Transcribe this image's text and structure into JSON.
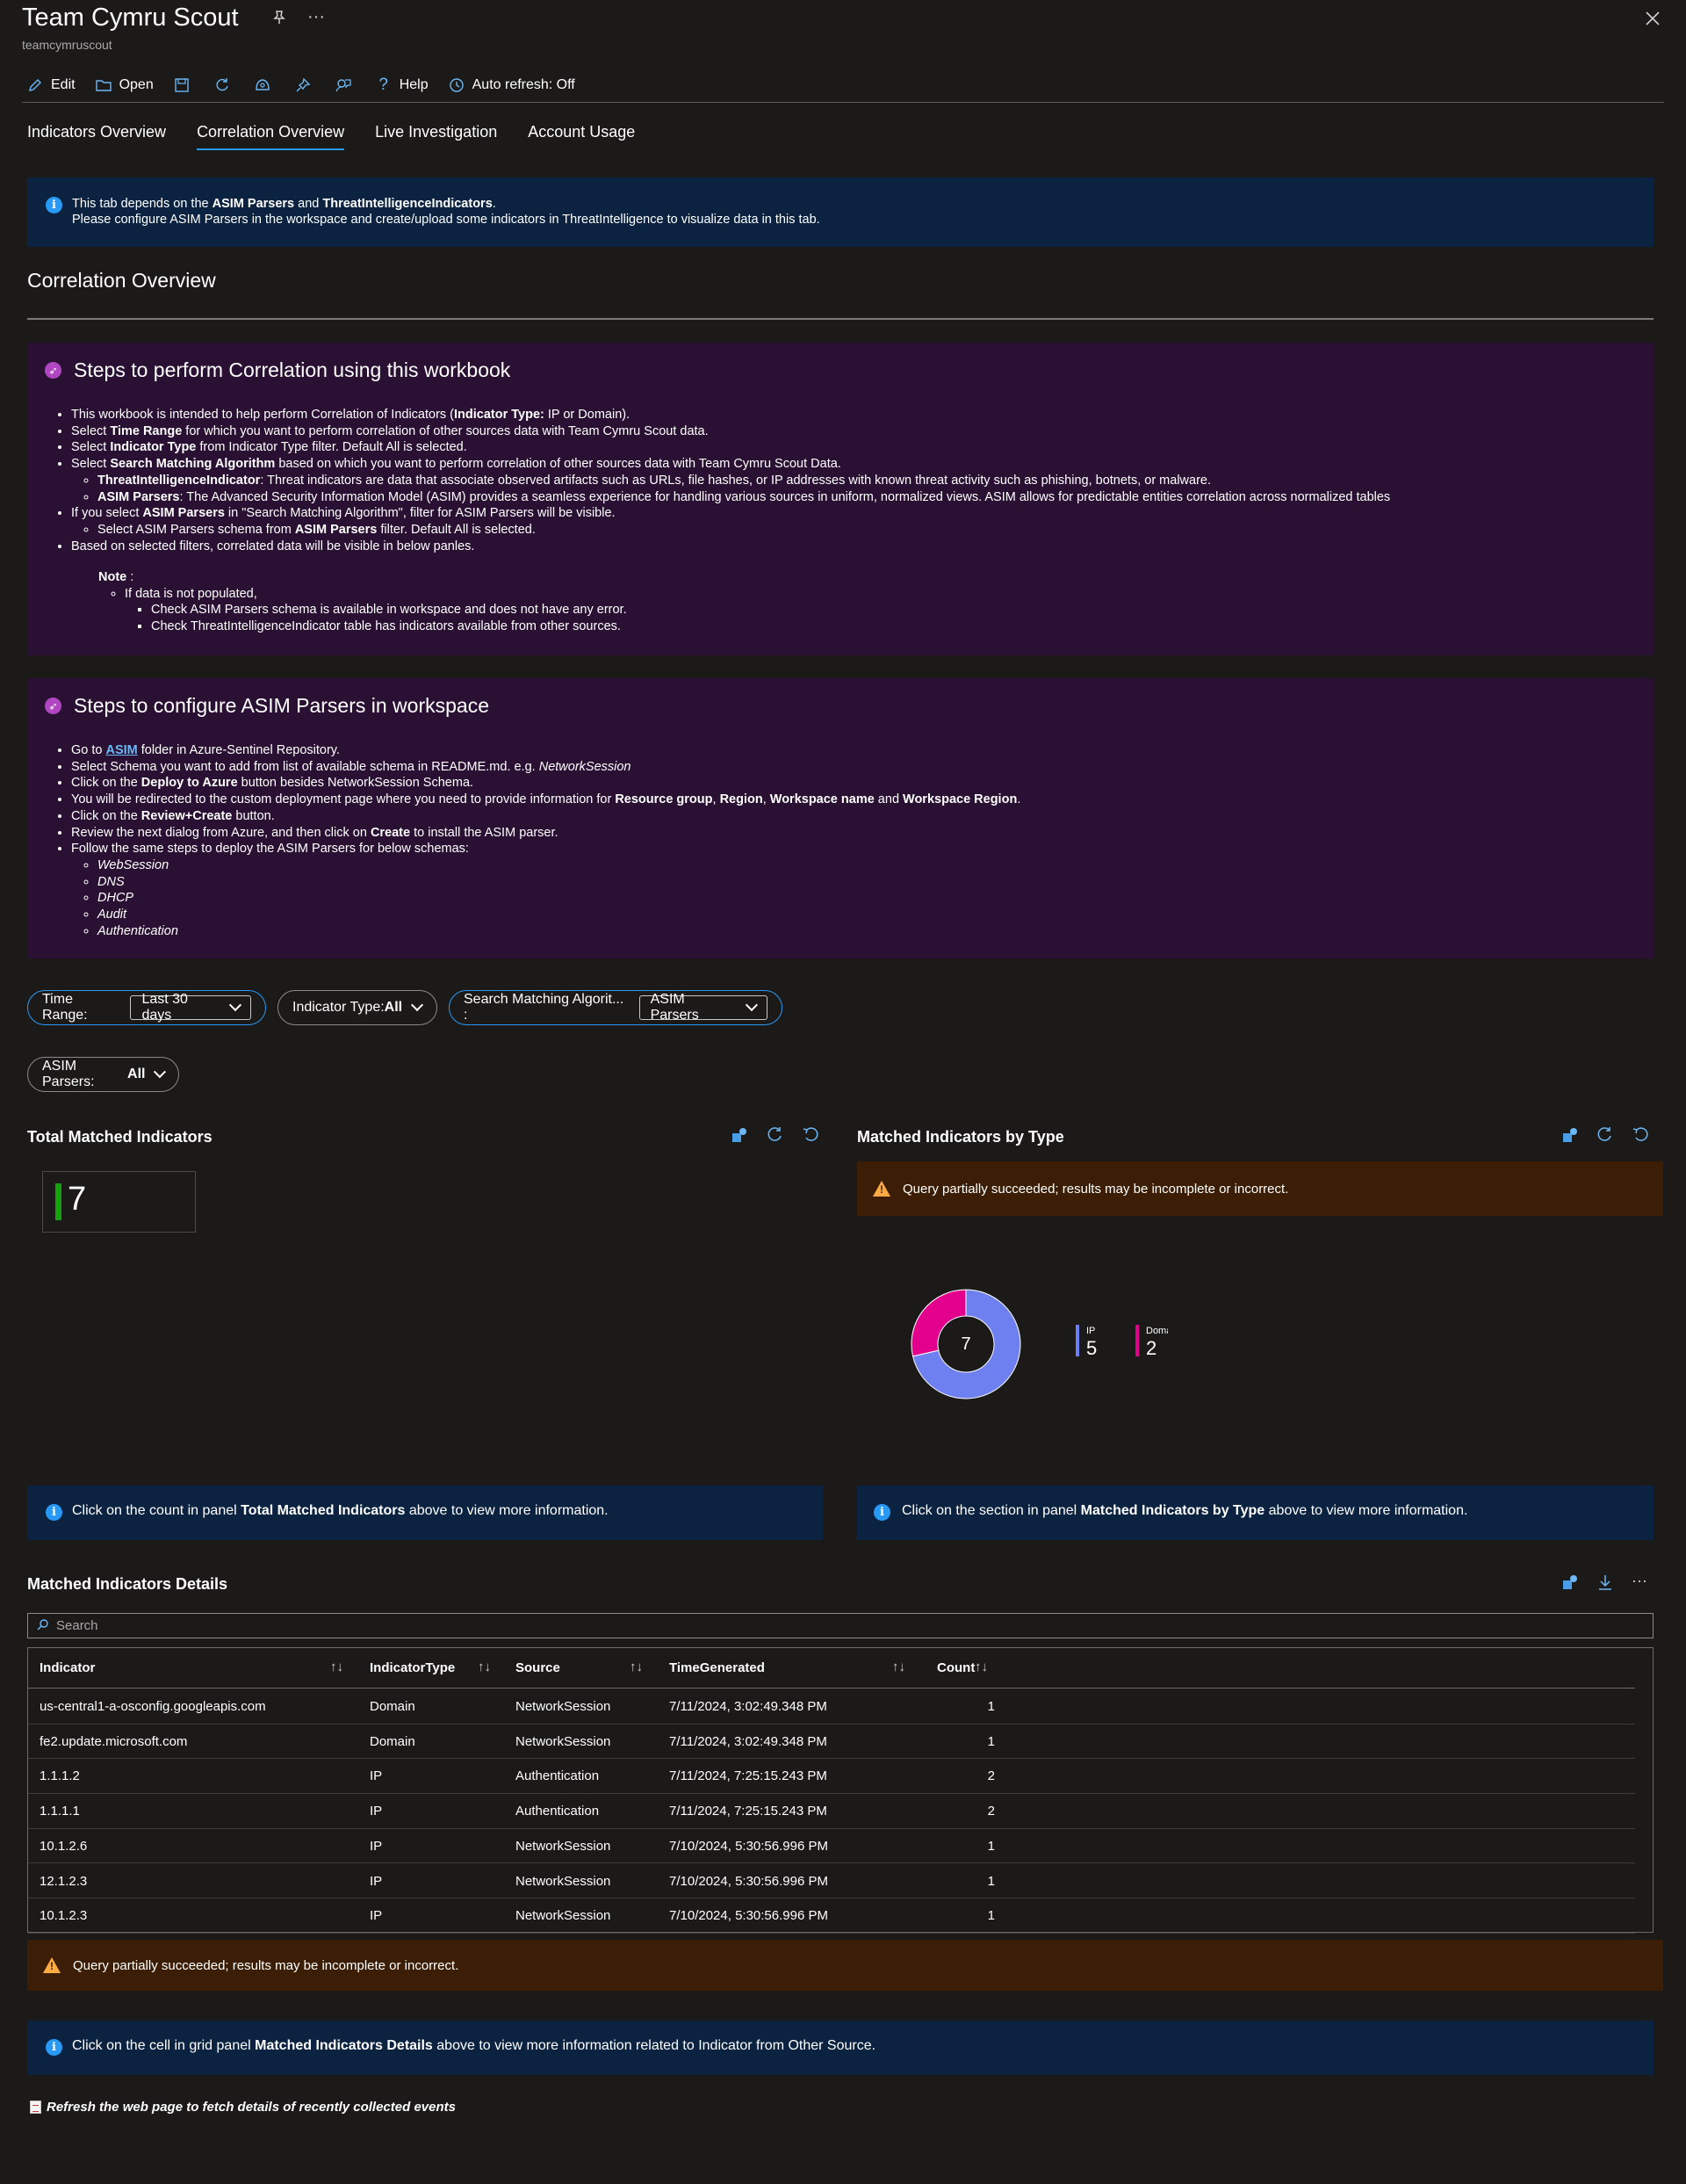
{
  "header": {
    "title": "Team Cymru Scout",
    "subtitle": "teamcymruscout"
  },
  "toolbar": {
    "edit": "Edit",
    "open": "Open",
    "help": "Help",
    "auto_refresh": "Auto refresh: Off"
  },
  "tabs": [
    {
      "label": "Indicators Overview",
      "active": false
    },
    {
      "label": "Correlation Overview",
      "active": true
    },
    {
      "label": "Live Investigation",
      "active": false
    },
    {
      "label": "Account Usage",
      "active": false
    }
  ],
  "top_banner": {
    "l1_a": "This tab depends on the ",
    "l1_b": "ASIM Parsers",
    "l1_c": " and ",
    "l1_d": "ThreatIntelligenceIndicators",
    "l1_e": ".",
    "line2": "Please configure ASIM Parsers in the workspace and create/upload some indicators in ThreatIntelligence to visualize data in this tab."
  },
  "section_title": "Correlation Overview",
  "steps_correlation": {
    "heading": "Steps to perform Correlation using this workbook",
    "b1_a": "This workbook is intended to help perform Correlation of Indicators (",
    "b1_b": "Indicator Type:",
    "b1_c": " IP or Domain).",
    "b2_a": "Select ",
    "b2_b": "Time Range",
    "b2_c": " for which you want to perform correlation of other sources data with Team Cymru Scout data.",
    "b3_a": "Select ",
    "b3_b": "Indicator Type",
    "b3_c": " from Indicator Type filter. Default All is selected.",
    "b4_a": "Select ",
    "b4_b": "Search Matching Algorithm",
    "b4_c": " based on which you want to perform correlation of other sources data with Team Cymru Scout Data.",
    "b4s1_a": "ThreatIntelligenceIndicator",
    "b4s1_b": ": Threat indicators are data that associate observed artifacts such as URLs, file hashes, or IP addresses with known threat activity such as phishing, botnets, or malware.",
    "b4s2_a": "ASIM Parsers",
    "b4s2_b": ": The Advanced Security Information Model (ASIM) provides a seamless experience for handling various sources in uniform, normalized views. ASIM allows for predictable entities correlation across normalized tables",
    "b5_a": "If you select ",
    "b5_b": "ASIM Parsers",
    "b5_c": " in \"Search Matching Algorithm\", filter for ASIM Parsers will be visible.",
    "b5s1_a": "Select ASIM Parsers schema from ",
    "b5s1_b": "ASIM Parsers",
    "b5s1_c": " filter. Default All is selected.",
    "b6": "Based on selected filters, correlated data will be visible in below panles.",
    "note": "Note",
    "note_colon": " :",
    "n1": "If data is not populated,",
    "n1s1": "Check ASIM Parsers schema is available in workspace and does not have any error.",
    "n1s2": "Check ThreatIntelligenceIndicator table has indicators available from other sources."
  },
  "steps_asim": {
    "heading": "Steps to configure ASIM Parsers in workspace",
    "b1_a": "Go to ",
    "b1_link": "ASIM",
    "b1_c": " folder in Azure-Sentinel Repository.",
    "b2_a": "Select Schema you want to add from list of available schema in README.md. e.g. ",
    "b2_b": "NetworkSession",
    "b3_a": "Click on the ",
    "b3_b": "Deploy to Azure",
    "b3_c": " button besides NetworkSession Schema.",
    "b4_a": "You will be redirected to the custom deployment page where you need to provide information for ",
    "b4_b": "Resource group",
    "b4_c": ", ",
    "b4_d": "Region",
    "b4_e": ", ",
    "b4_f": "Workspace name",
    "b4_g": " and ",
    "b4_h": "Workspace Region",
    "b4_i": ".",
    "b5_a": "Click on the ",
    "b5_b": "Review+Create",
    "b5_c": " button.",
    "b6_a": "Review the next dialog from Azure, and then click on ",
    "b6_b": "Create",
    "b6_c": " to install the ASIM parser.",
    "b7": "Follow the same steps to deploy the ASIM Parsers for below schemas:",
    "schemas": [
      "WebSession",
      "DNS",
      "DHCP",
      "Audit",
      "Authentication"
    ]
  },
  "filters": {
    "time_range_label": "Time Range:",
    "time_range_value": "Last 30 days",
    "indicator_type_label": "Indicator Type: ",
    "indicator_type_value": "All",
    "search_algo_label": "Search Matching Algorit... :",
    "search_algo_value": "ASIM Parsers",
    "asim_parsers_label": "ASIM Parsers: ",
    "asim_parsers_value": "All"
  },
  "panel_total": {
    "title": "Total Matched Indicators",
    "value": "7"
  },
  "panel_by_type": {
    "title": "Matched Indicators by Type",
    "warning": "Query partially succeeded; results may be incomplete or incorrect.",
    "center_total": "7"
  },
  "chart_data": {
    "type": "pie",
    "donut": true,
    "categories": [
      "IP",
      "Domain"
    ],
    "values": [
      5,
      2
    ],
    "colors": [
      "#6e7ff0",
      "#e3008c"
    ],
    "center_label": "7",
    "legend_position": "right"
  },
  "info_total": {
    "a": "Click on the count in panel ",
    "b": "Total Matched Indicators",
    "c": " above to view more information."
  },
  "info_type": {
    "a": "Click on the section in panel ",
    "b": "Matched Indicators by Type",
    "c": " above to view more information."
  },
  "details": {
    "title": "Matched Indicators Details",
    "search_placeholder": "Search",
    "columns": [
      "Indicator",
      "IndicatorType",
      "Source",
      "TimeGenerated",
      "Count"
    ],
    "rows": [
      [
        "us-central1-a-osconfig.googleapis.com",
        "Domain",
        "NetworkSession",
        "7/11/2024, 3:02:49.348 PM",
        "1"
      ],
      [
        "fe2.update.microsoft.com",
        "Domain",
        "NetworkSession",
        "7/11/2024, 3:02:49.348 PM",
        "1"
      ],
      [
        "1.1.1.2",
        "IP",
        "Authentication",
        "7/11/2024, 7:25:15.243 PM",
        "2"
      ],
      [
        "1.1.1.1",
        "IP",
        "Authentication",
        "7/11/2024, 7:25:15.243 PM",
        "2"
      ],
      [
        "10.1.2.6",
        "IP",
        "NetworkSession",
        "7/10/2024, 5:30:56.996 PM",
        "1"
      ],
      [
        "12.1.2.3",
        "IP",
        "NetworkSession",
        "7/10/2024, 5:30:56.996 PM",
        "1"
      ],
      [
        "10.1.2.3",
        "IP",
        "NetworkSession",
        "7/10/2024, 5:30:56.996 PM",
        "1"
      ]
    ],
    "warning": "Query partially succeeded; results may be incomplete or incorrect."
  },
  "info_grid": {
    "a": "Click on the cell in grid panel ",
    "b": "Matched Indicators Details",
    "c": " above to view more information related to Indicator from Other Source."
  },
  "footer_note": "Refresh the web page to fetch details of recently collected events"
}
